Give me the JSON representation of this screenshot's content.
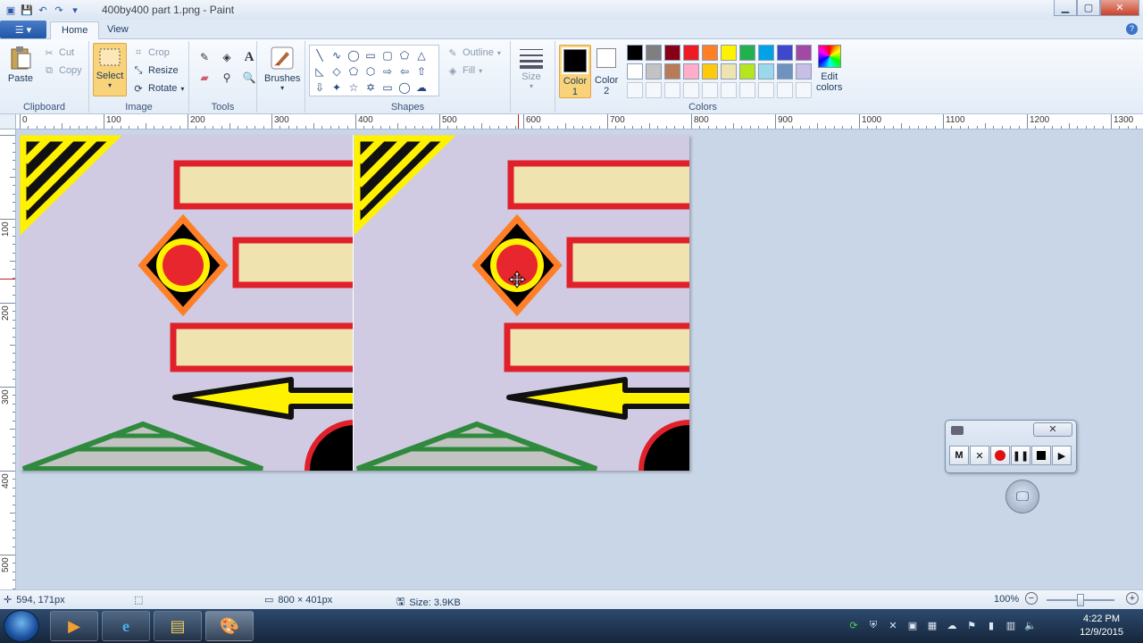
{
  "window": {
    "title": "400by400 part 1.png - Paint"
  },
  "tabs": {
    "home": "Home",
    "view": "View"
  },
  "clipboard": {
    "paste": "Paste",
    "cut": "Cut",
    "copy": "Copy",
    "label": "Clipboard"
  },
  "image": {
    "select": "Select",
    "crop": "Crop",
    "resize": "Resize",
    "rotate": "Rotate",
    "label": "Image"
  },
  "tools": {
    "label": "Tools"
  },
  "brushes": {
    "label": "Brushes"
  },
  "shapes": {
    "outline": "Outline",
    "fill": "Fill",
    "label": "Shapes"
  },
  "size": {
    "label": "Size"
  },
  "colors": {
    "color1_label": "Color\n1",
    "color2_label": "Color\n2",
    "edit_label": "Edit\ncolors",
    "label": "Colors",
    "palette_row1": [
      "#000000",
      "#7f7f7f",
      "#880015",
      "#ed1c24",
      "#ff7f27",
      "#fff200",
      "#22b14c",
      "#00a2e8",
      "#3f48cc",
      "#a349a4"
    ],
    "palette_row2": [
      "#ffffff",
      "#c3c3c3",
      "#b97a57",
      "#ffaec9",
      "#ffc90e",
      "#efe4b0",
      "#b5e61d",
      "#99d9ea",
      "#7092be",
      "#c8bfe7"
    ]
  },
  "ruler_h": [
    "0",
    "100",
    "200",
    "300",
    "400",
    "500",
    "600",
    "700",
    "800",
    "900",
    "1000",
    "1100",
    "1200",
    "1300"
  ],
  "ruler_v": [
    "100",
    "200",
    "300",
    "400",
    "500"
  ],
  "status": {
    "cursor": "594, 171px",
    "selection": "",
    "dimensions": "800 × 401px",
    "size": "Size: 3.9KB",
    "zoom": "100%"
  },
  "recorder": {
    "m": "M",
    "x": "✕"
  },
  "clock": {
    "time": "4:22 PM",
    "date": "12/9/2015"
  }
}
